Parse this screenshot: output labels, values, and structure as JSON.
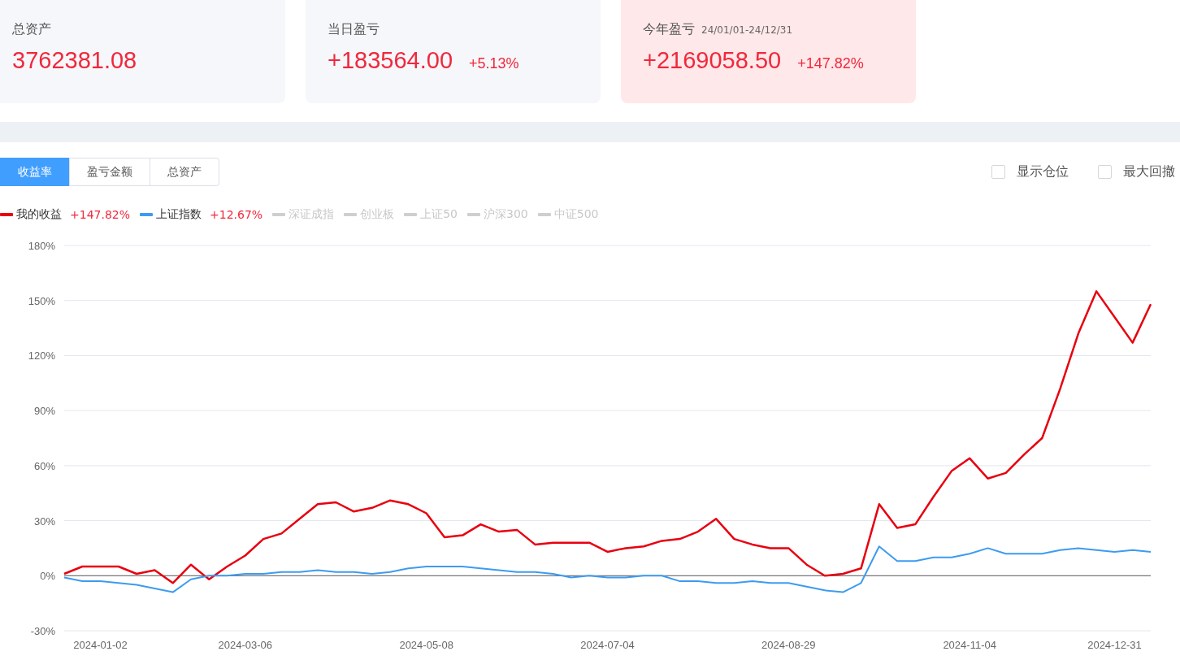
{
  "summary_cards": [
    {
      "label": "总资产",
      "value": "3762381.08",
      "highlighted": false
    },
    {
      "label": "当日盈亏",
      "value": "+183564.00",
      "change": "+5.13%",
      "highlighted": false
    },
    {
      "label": "今年盈亏",
      "date_range": "24/01/01-24/12/31",
      "value": "+2169058.50",
      "change": "+147.82%",
      "highlighted": true
    }
  ],
  "tabs": [
    {
      "label": "收益率",
      "selected": true
    },
    {
      "label": "盈亏金额",
      "selected": false
    },
    {
      "label": "总资产",
      "selected": false
    }
  ],
  "options": [
    {
      "label": "显示仓位",
      "checked": false
    },
    {
      "label": "最大回撤",
      "checked": false
    }
  ],
  "legend": [
    {
      "value": "+147.82%",
      "on": true
    },
    {
      "value": "+12.67%",
      "on": true
    },
    {
      "label": "深证成指",
      "on": false
    },
    {
      "label": "创业板",
      "on": false
    },
    {
      "label": "上证50",
      "on": false
    },
    {
      "label": "沪深300",
      "on": false
    },
    {
      "label": "中证500",
      "on": false
    }
  ],
  "chart_data": {
    "type": "line",
    "categories": [
      null,
      null,
      "2024-01-02",
      null,
      null,
      null,
      null,
      null,
      null,
      null,
      "2024-03-06",
      null,
      null,
      null,
      null,
      null,
      null,
      null,
      null,
      null,
      "2024-05-08",
      null,
      null,
      null,
      null,
      null,
      null,
      null,
      null,
      null,
      "2024-07-04",
      null,
      null,
      null,
      null,
      null,
      null,
      null,
      null,
      null,
      "2024-08-29",
      null,
      null,
      null,
      null,
      null,
      null,
      null,
      null,
      null,
      "2024-11-04",
      null,
      null,
      null,
      null,
      null,
      null,
      null,
      "2024-12-31",
      null,
      null
    ],
    "ylim": [
      -30,
      180
    ],
    "grid": true,
    "yticks": [
      {
        "value": -30,
        "label": "-30%"
      },
      {
        "value": 0,
        "label": "0%"
      },
      {
        "value": 30,
        "label": "30%"
      },
      {
        "value": 60,
        "label": "60%"
      },
      {
        "value": 90,
        "label": "90%"
      },
      {
        "value": 120,
        "label": "120%"
      },
      {
        "value": 150,
        "label": "150%"
      },
      {
        "value": 180,
        "label": "180%"
      }
    ],
    "series": [
      {
        "name": "我的收益",
        "color": "#e8000f",
        "values": [
          1,
          5,
          5,
          5,
          1,
          3,
          -4,
          6,
          -2,
          5,
          11,
          20,
          23,
          31,
          39,
          40,
          35,
          37,
          41,
          39,
          34,
          21,
          22,
          28,
          24,
          25,
          17,
          18,
          18,
          18,
          13,
          15,
          16,
          19,
          20,
          24,
          31,
          20,
          17,
          15,
          15,
          6,
          0,
          1,
          4,
          39,
          26,
          28,
          43,
          57,
          64,
          53,
          56,
          66,
          75,
          102,
          132,
          155,
          141,
          127,
          148
        ]
      },
      {
        "name": "上证指数",
        "color": "#3d9bf0",
        "values": [
          -1,
          -3,
          -3,
          -4,
          -5,
          -7,
          -9,
          -2,
          0,
          0,
          1,
          1,
          2,
          2,
          3,
          2,
          2,
          1,
          2,
          4,
          5,
          5,
          5,
          4,
          3,
          2,
          2,
          1,
          -1,
          0,
          -1,
          -1,
          0,
          0,
          -3,
          -3,
          -4,
          -4,
          -3,
          -4,
          -4,
          -6,
          -8,
          -9,
          -4,
          16,
          8,
          8,
          10,
          10,
          12,
          15,
          12,
          12,
          12,
          14,
          15,
          14,
          13,
          14,
          13
        ]
      }
    ]
  }
}
